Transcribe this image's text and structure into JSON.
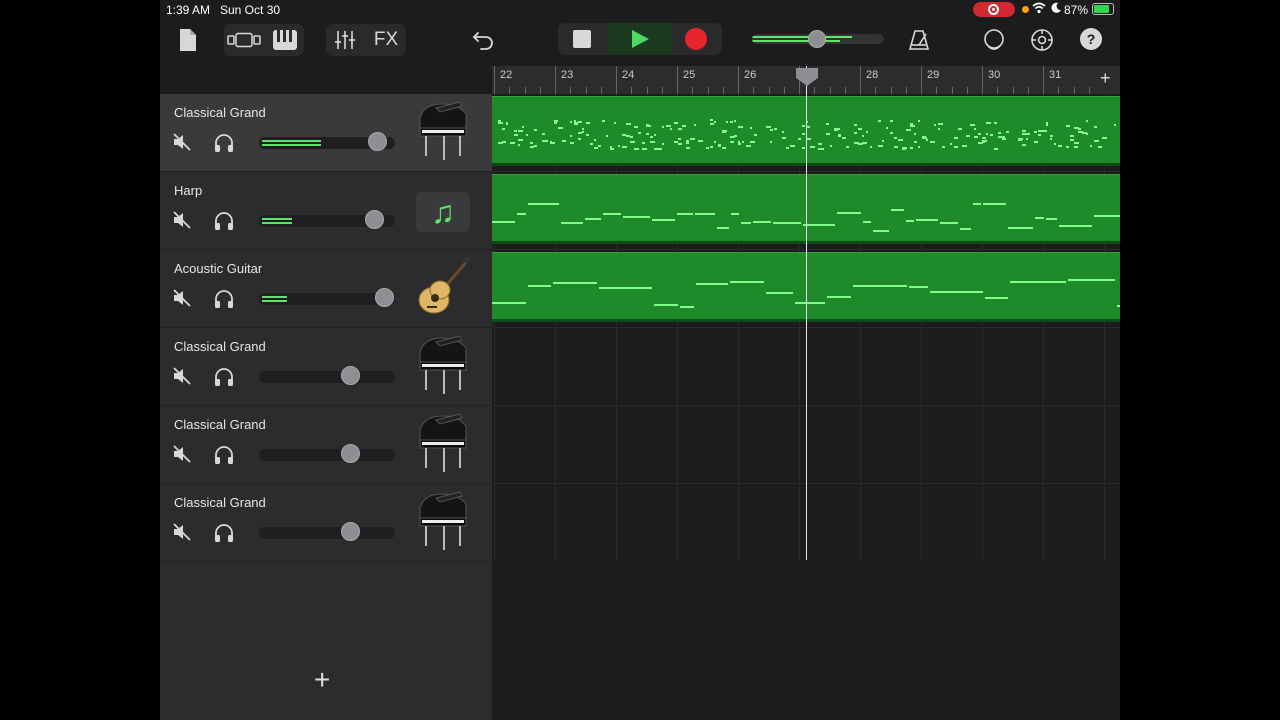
{
  "status": {
    "time": "1:39 AM",
    "date": "Sun Oct 30",
    "battery": "87%"
  },
  "toolbar": {
    "fx_label": "FX",
    "icons": [
      "document-icon",
      "tracks-view-icon",
      "keyboard-icon",
      "mixer-icon",
      "undo-icon",
      "stop-icon",
      "play-icon",
      "record-icon",
      "metronome-icon",
      "loop-icon",
      "settings-icon",
      "help-icon"
    ],
    "accent": "#5ee46a",
    "record_color": "#e8242c",
    "help_label": "?"
  },
  "ruler": {
    "bars": [
      "22",
      "23",
      "24",
      "25",
      "26",
      "27",
      "28",
      "29",
      "30",
      "31"
    ],
    "add_label": "+"
  },
  "tracks": [
    {
      "name": "Classical Grand",
      "instrument": "piano-icon",
      "volume": 0.45,
      "has_region": true,
      "selected": true
    },
    {
      "name": "Harp",
      "instrument": "music-note-icon",
      "volume": 0.23,
      "has_region": true,
      "selected": false
    },
    {
      "name": "Acoustic Guitar",
      "instrument": "guitar-icon",
      "volume": 0.19,
      "has_region": true,
      "selected": false
    },
    {
      "name": "Classical Grand",
      "instrument": "piano-icon",
      "volume": 0.0,
      "has_region": false,
      "selected": false
    },
    {
      "name": "Classical Grand",
      "instrument": "piano-icon",
      "volume": 0.0,
      "has_region": false,
      "selected": false
    },
    {
      "name": "Classical Grand",
      "instrument": "piano-icon",
      "volume": 0.0,
      "has_region": false,
      "selected": false
    }
  ],
  "add_track_label": "+",
  "region_color": "#1e8a2a"
}
